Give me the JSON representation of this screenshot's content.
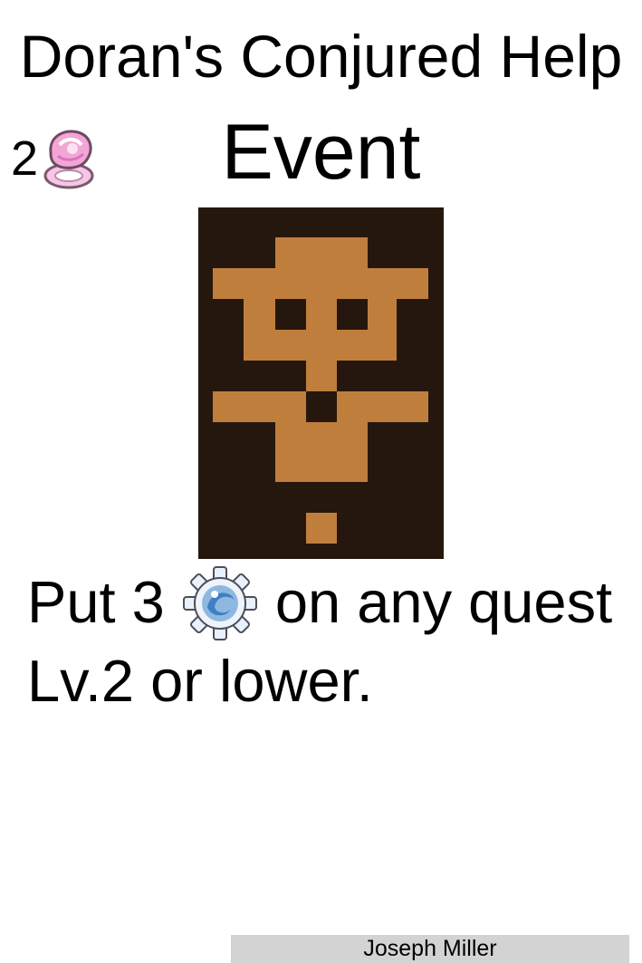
{
  "card": {
    "title": "Doran's Conjured Help",
    "cost": "2",
    "cost_icon": "pink-crystal-ring-icon",
    "type": "Event",
    "art_icon": "pixel-figure-portrait",
    "text": {
      "part1": "Put 3",
      "token_icon": "blue-gear-token-icon",
      "part2": "on any quest",
      "line2": "Lv.2 or lower."
    },
    "artist": "Joseph Miller"
  },
  "colors": {
    "art_background": "#26170e",
    "art_figure": "#c07e3d",
    "artist_bar": "#d3d3d3",
    "crystal": "#f0a8d8",
    "gear": "#8fb8e0"
  }
}
